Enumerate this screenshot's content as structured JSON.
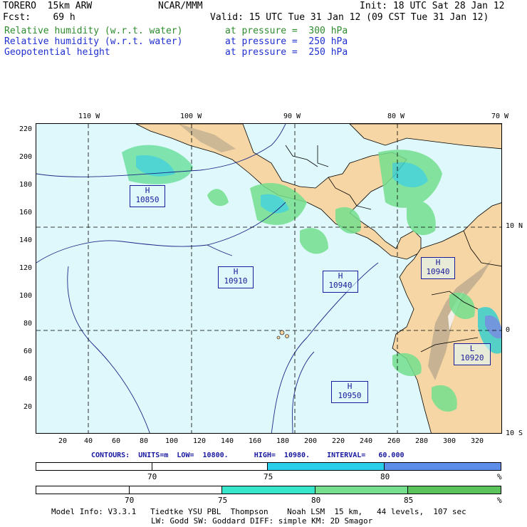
{
  "header": {
    "model": "TORERO  15km ARW",
    "org": "NCAR/MMM",
    "init": "Init: 18 UTC Sat 28 Jan 12",
    "fcst": "Fcst:    69 h",
    "valid": "Valid: 15 UTC Tue 31 Jan 12 (09 CST Tue 31 Jan 12)",
    "fields": [
      {
        "name": "Relative humidity (w.r.t. water)",
        "level": "at pressure =  300 hPa",
        "color": "#2e8b2e"
      },
      {
        "name": "Relative humidity (w.r.t. water)",
        "level": "at pressure =  250 hPa",
        "color": "#1f2fd0"
      },
      {
        "name": "Geopotential height",
        "level": "at pressure =  250 hPa",
        "color": "#1f2fd0"
      }
    ]
  },
  "map": {
    "lon_labels": [
      "110 W",
      "100 W",
      "90 W",
      "80 W",
      "70 W"
    ],
    "lat_labels": [
      "10 N",
      "0",
      "10 S"
    ],
    "y_ticks": [
      "220",
      "200",
      "180",
      "160",
      "140",
      "120",
      "100",
      "80",
      "60",
      "40",
      "20"
    ],
    "x_ticks": [
      "20",
      "40",
      "60",
      "80",
      "100",
      "120",
      "140",
      "160",
      "180",
      "200",
      "220",
      "240",
      "260",
      "280",
      "300",
      "320"
    ],
    "highs": [
      {
        "letter": "H",
        "value": "10850"
      },
      {
        "letter": "H",
        "value": "10910"
      },
      {
        "letter": "H",
        "value": "10940"
      },
      {
        "letter": "H",
        "value": "10940"
      },
      {
        "letter": "H",
        "value": "10950"
      }
    ],
    "low": {
      "letter": "L",
      "value": "10920"
    }
  },
  "contours_text": "CONTOURS:  UNITS=m  LOW=  10800.      HIGH=  10980.    INTERVAL=   60.000",
  "colorbar1": {
    "labels": [
      "70",
      "75",
      "80",
      "%"
    ],
    "colors": [
      "#ffffff",
      "#ffffff",
      "#29cfe8",
      "#5c8de8"
    ]
  },
  "colorbar2": {
    "labels": [
      "70",
      "75",
      "80",
      "85",
      "%"
    ],
    "colors": [
      "#ffffff",
      "#ffffff",
      "#38e6cc",
      "#74e08e",
      "#5cc45c"
    ]
  },
  "footer": {
    "line1": "Model Info: V3.3.1   Tiedtke YSU PBL  Thompson    Noah LSM  15 km,   44 levels,  107 sec",
    "line2": "LW: Godd SW: Goddard DIFF: simple KM: 2D Smagor"
  }
}
